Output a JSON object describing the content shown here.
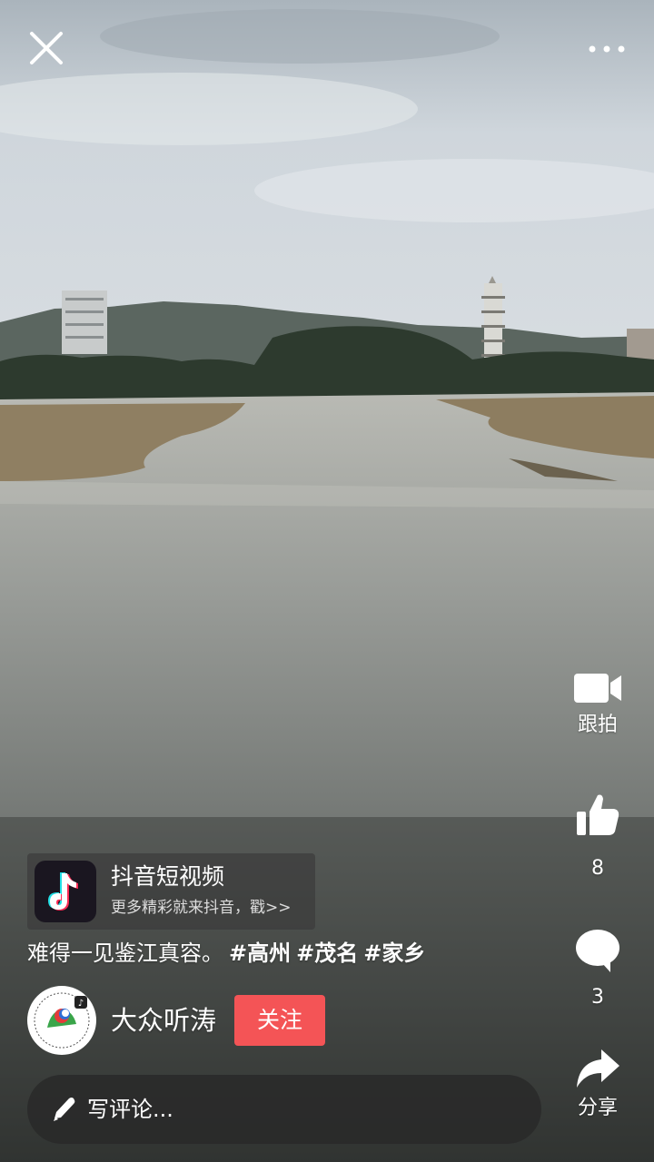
{
  "header": {
    "close_icon": "close-icon",
    "more_icon": "more-dots-icon"
  },
  "actions": {
    "shoot": {
      "label": "跟拍",
      "icon": "video-camera-icon"
    },
    "like": {
      "count": "8",
      "icon": "thumbs-up-icon"
    },
    "comment": {
      "count": "3",
      "icon": "speech-bubble-icon"
    },
    "share": {
      "label": "分享",
      "icon": "share-arrow-icon"
    }
  },
  "promo": {
    "title": "抖音短视频",
    "subtitle": "更多精彩就来抖音，戳>>",
    "icon": "tiktok-logo-icon"
  },
  "caption": {
    "text": "难得一见鉴江真容。",
    "tags": [
      "#高州",
      "#茂名",
      "#家乡"
    ]
  },
  "author": {
    "name": "大众听涛",
    "follow_label": "关注",
    "avatar_icon": "avatar-logo"
  },
  "comment_box": {
    "placeholder": "写评论...",
    "icon": "pencil-icon"
  },
  "colors": {
    "follow_button": "#f45456",
    "text": "#ffffff",
    "sky": "#c9d0d6",
    "river": "#8a8f8c"
  }
}
